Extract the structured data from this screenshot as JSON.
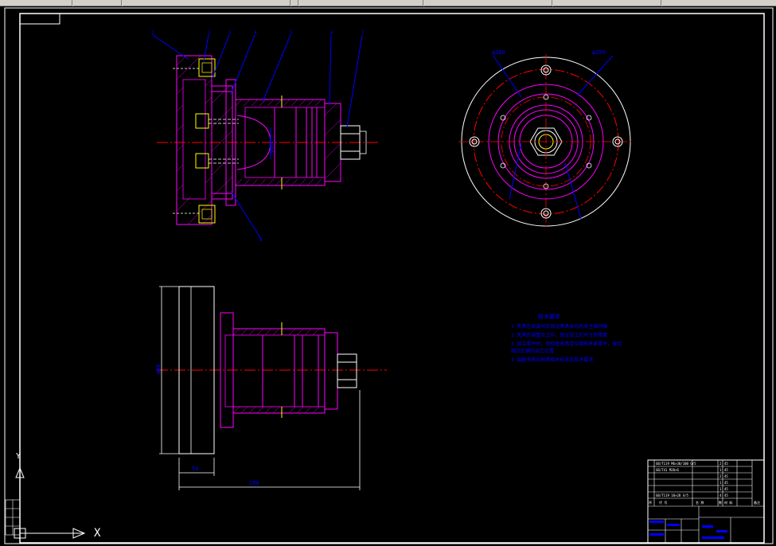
{
  "colors": {
    "background": "#000000",
    "frame": "#ffffff",
    "part": "#ff00ff",
    "centerline": "#ff0000",
    "dimension": "#0000ff",
    "annotation": "#0000ff",
    "nut": "#ffffff",
    "insert": "#ffff00",
    "toolbar": "#d4d0c8"
  },
  "dimensions": {
    "front_bore": "φ108",
    "top_dia_left": "φ280",
    "top_dia_right": "φ250",
    "side_height": "φ80",
    "side_thickness": "54",
    "side_length": "280"
  },
  "leader_numbers": [
    "1",
    "2",
    "3",
    "4",
    "5",
    "6",
    "7",
    "8"
  ],
  "tech_requirements": {
    "title": "技术要求",
    "items": [
      "1  夹具在安装时应保证夹具体与机床主轴同轴",
      "2  夹具的调整及工作，保证加工的尺寸及精度",
      "3  加工零件时，须检查夹具定位面和夹紧零件，保持",
      "    相应正确的加工位置",
      "4  装配夹具应按照相关标准及技术要求"
    ]
  },
  "parts_list": {
    "rows": [
      {
        "code": "GB/T119 M6×30/100 Gr5",
        "qty": "2",
        "material": "45"
      },
      {
        "code": "GB/T41 M20×6",
        "qty": "1",
        "material": "45"
      },
      {
        "code": "",
        "qty": "2",
        "material": "45"
      },
      {
        "code": "",
        "qty": "1",
        "material": "45"
      },
      {
        "code": "",
        "qty": "1",
        "material": "45"
      },
      {
        "code": "GB/T119 10×28 Gr5",
        "qty": "4",
        "material": "45"
      }
    ],
    "header": [
      "序",
      "代  号",
      "名  称",
      "数",
      "材  料",
      "备注"
    ]
  },
  "ucs": {
    "x_label": "X",
    "y_label": "Y"
  }
}
